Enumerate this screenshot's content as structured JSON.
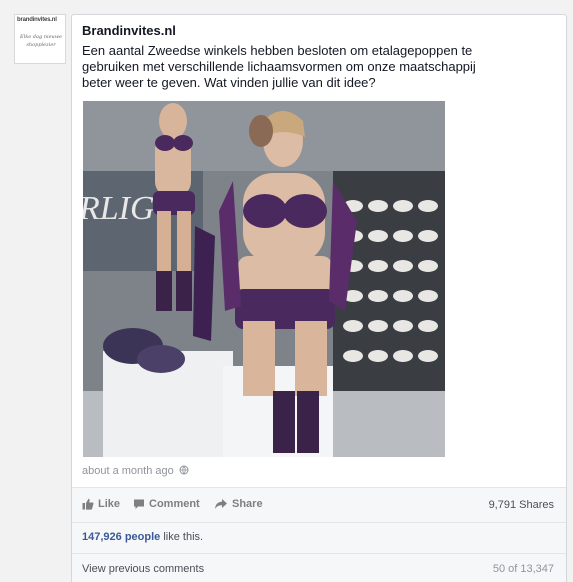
{
  "avatar": {
    "brand": "brandinvites.nl",
    "tagline": "Elke dag nieuwe shopplezier"
  },
  "post": {
    "page_name": "Brandinvites.nl",
    "text": "Een aantal Zweedse winkels hebben besloten om etalagepoppen te gebruiken met verschillende lichaamsvormen om onze maatschappij beter weer te geven. Wat vinden jullie van dit idee?",
    "photo_sign_text": "RLIG",
    "timestamp": "about a month ago"
  },
  "actions": {
    "like": "Like",
    "comment": "Comment",
    "share": "Share",
    "shares_count": "9,791 Shares"
  },
  "likes": {
    "count": "147,926 people",
    "suffix": " like this."
  },
  "comments": {
    "view_previous": "View previous comments",
    "count": "50 of 13,347"
  },
  "colors": {
    "link": "#3b5998",
    "text": "#141823",
    "muted": "#90949c",
    "lingerie": "#4a2a5e"
  },
  "icons": {
    "like": "thumbs-up-icon",
    "comment": "speech-bubble-icon",
    "share": "share-arrow-icon",
    "globe": "globe-icon"
  }
}
